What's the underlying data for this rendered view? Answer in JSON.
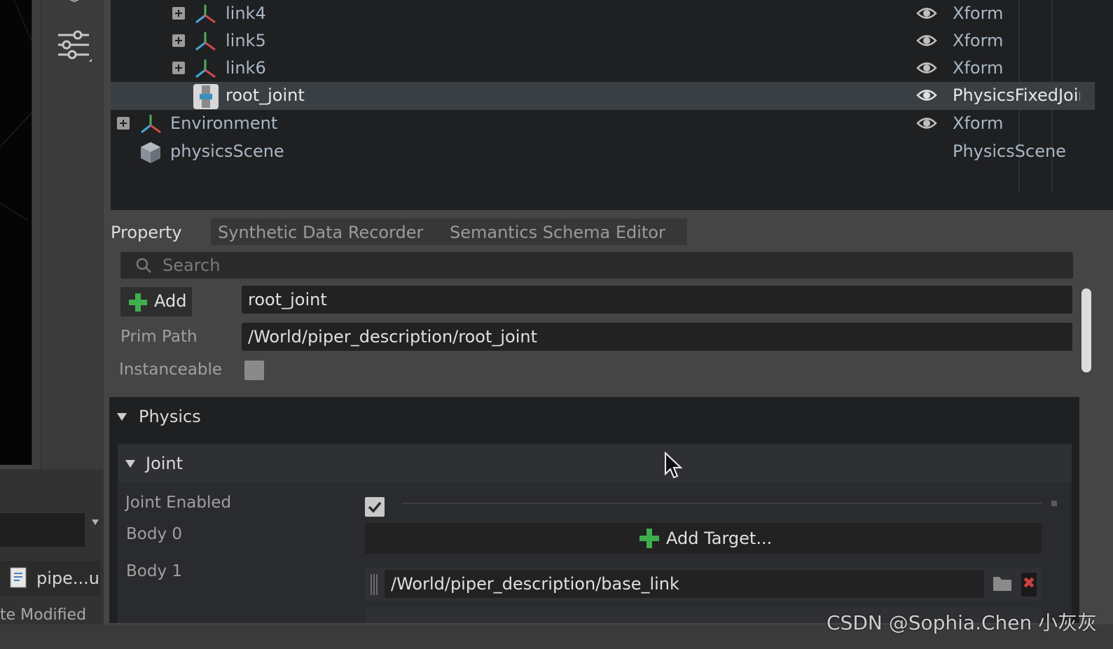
{
  "stage": {
    "rows": [
      {
        "name": "link4",
        "type": "Xform"
      },
      {
        "name": "link5",
        "type": "Xform"
      },
      {
        "name": "link6",
        "type": "Xform"
      },
      {
        "name": "root_joint",
        "type": "PhysicsFixedJoint"
      },
      {
        "name": "Environment",
        "type": "Xform"
      },
      {
        "name": "physicsScene",
        "type": "PhysicsScene"
      }
    ],
    "selected": "root_joint"
  },
  "tabs": [
    "Property",
    "Synthetic Data Recorder",
    "Semantics Schema Editor"
  ],
  "property": {
    "search_placeholder": "Search",
    "add_label": "Add",
    "prim_name": "root_joint",
    "prim_path_label": "Prim Path",
    "prim_path": "/World/piper_description/root_joint",
    "instanceable_label": "Instanceable"
  },
  "physics": {
    "title": "Physics",
    "joint": {
      "title": "Joint",
      "enabled_label": "Joint Enabled",
      "enabled": true,
      "body0_label": "Body 0",
      "add_target_label": "Add Target...",
      "body1_label": "Body 1",
      "body1_path": "/World/piper_description/base_link"
    }
  },
  "content": {
    "file_name": "pipe...ur",
    "column_label": "te Modified"
  },
  "watermark": "CSDN @Sophia.Chen 小灰灰",
  "colors": {
    "xform_red": "#d04a4a",
    "xform_green": "#4cae5a",
    "xform_blue": "#4aa3d8",
    "add_green": "#3fae4c"
  }
}
